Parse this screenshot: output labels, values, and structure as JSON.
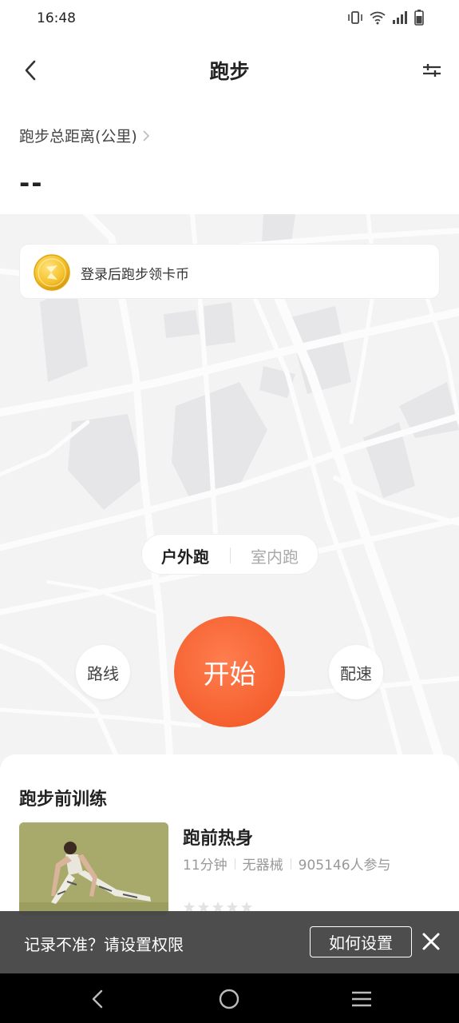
{
  "status_bar": {
    "time": "16:48",
    "icons": [
      "vibrate-icon",
      "wifi-icon",
      "signal-icon",
      "battery-icon"
    ]
  },
  "header": {
    "title": "跑步",
    "back_icon": "chevron-left-icon",
    "filter_icon": "sliders-icon"
  },
  "summary": {
    "total_distance_label": "跑步总距离(公里)",
    "total_distance_value": "--"
  },
  "coin_banner": {
    "text": "登录后跑步领卡币",
    "icon": "coin-icon"
  },
  "mode_switch": {
    "options": [
      "户外跑",
      "室内跑"
    ],
    "selected": "户外跑"
  },
  "actions": {
    "route_label": "路线",
    "start_label": "开始",
    "pace_label": "配速",
    "accent_color": "#f5602f"
  },
  "training": {
    "section_title": "跑步前训练",
    "course": {
      "name": "跑前热身",
      "duration": "11分钟",
      "equipment": "无器械",
      "participants": "905146人参与",
      "rating": 0,
      "rating_max": 5
    }
  },
  "toast": {
    "message": "记录不准？请设置权限",
    "button_label": "如何设置",
    "close_icon": "close-icon"
  },
  "nav_bar": {
    "items": [
      "back-icon",
      "home-icon",
      "menu-icon"
    ]
  }
}
